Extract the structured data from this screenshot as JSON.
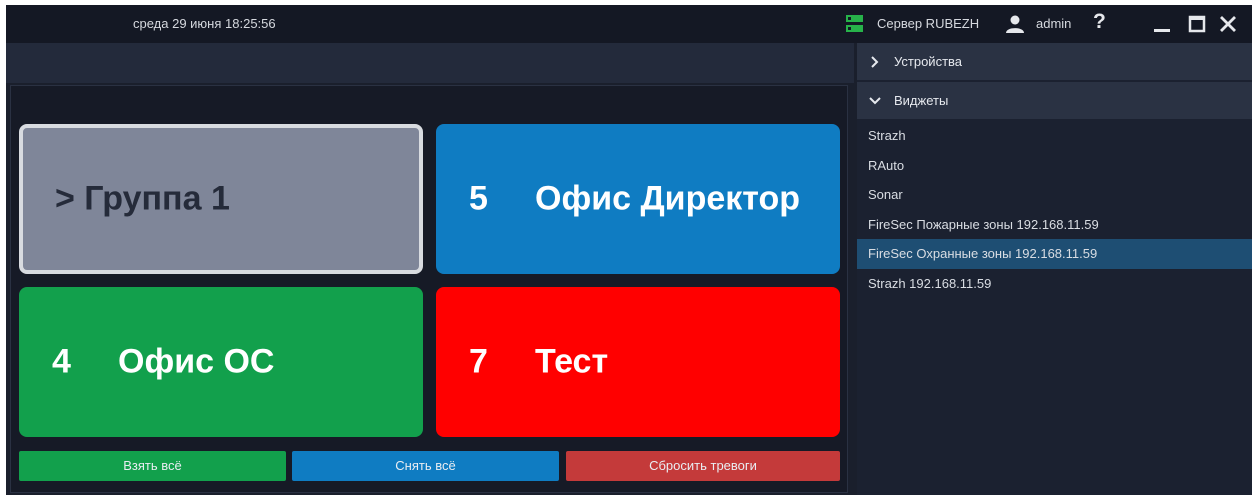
{
  "titlebar": {
    "datetime": "среда 29 июня 18:25:56",
    "server_label": "Сервер RUBEZH",
    "user_label": "admin",
    "help_label": "?",
    "server_icon_color": "#27b24a"
  },
  "tiles": {
    "group": {
      "title": "> Группа 1",
      "color": "#7f8699"
    },
    "director": {
      "number": "5",
      "title": "Офис Директор",
      "color": "#0f7cc2"
    },
    "os": {
      "number": "4",
      "title": "Офис ОС",
      "color": "#12a04c"
    },
    "test": {
      "number": "7",
      "title": "Тест",
      "color": "#ff0000"
    }
  },
  "actions": {
    "take_all": "Взять всё",
    "remove_all": "Снять всё",
    "reset_alarms": "Сбросить тревоги"
  },
  "sidebar": {
    "devices_label": "Устройства",
    "widgets_label": "Виджеты",
    "widgets": [
      {
        "label": "Strazh"
      },
      {
        "label": "RAuto"
      },
      {
        "label": "Sonar"
      },
      {
        "label": "FireSec Пожарные зоны 192.168.11.59"
      },
      {
        "label": "FireSec Охранные зоны 192.168.11.59",
        "selected": true
      },
      {
        "label": "Strazh 192.168.11.59"
      }
    ]
  },
  "icons": {
    "server": "server-icon",
    "user": "user-icon",
    "minimize": "minimize-icon",
    "maximize": "maximize-icon",
    "close": "close-icon",
    "collapsed": "chevron-right-icon",
    "expanded": "chevron-down-icon"
  }
}
